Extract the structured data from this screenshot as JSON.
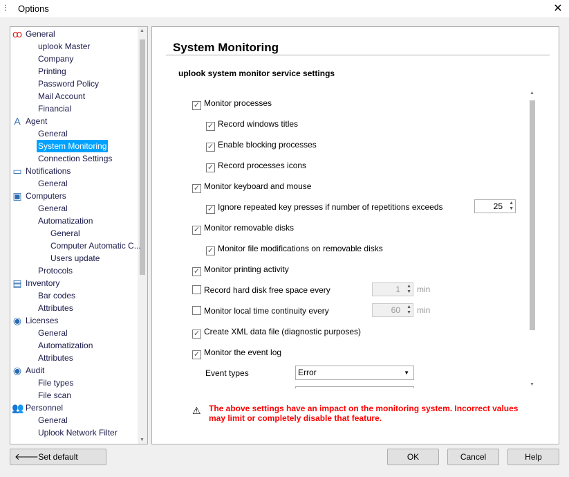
{
  "window": {
    "title": "Options",
    "close_icon": "close-icon"
  },
  "tree": {
    "items": [
      {
        "label": "General",
        "level": 0,
        "icon": "uplook-logo-icon"
      },
      {
        "label": "uplook Master",
        "level": 1
      },
      {
        "label": "Company",
        "level": 1
      },
      {
        "label": "Printing",
        "level": 1
      },
      {
        "label": "Password Policy",
        "level": 1
      },
      {
        "label": "Mail Account",
        "level": 1
      },
      {
        "label": "Financial",
        "level": 1
      },
      {
        "label": "Agent",
        "level": 0,
        "icon": "agent-a-icon"
      },
      {
        "label": "General",
        "level": 1
      },
      {
        "label": "System Monitoring",
        "level": 1,
        "selected": true
      },
      {
        "label": "Connection Settings",
        "level": 1
      },
      {
        "label": "Notifications",
        "level": 0,
        "icon": "chat-bubble-icon"
      },
      {
        "label": "General",
        "level": 1
      },
      {
        "label": "Computers",
        "level": 0,
        "icon": "computers-icon"
      },
      {
        "label": "General",
        "level": 1
      },
      {
        "label": "Automatization",
        "level": 1
      },
      {
        "label": "General",
        "level": 2
      },
      {
        "label": "Computer Automatic C...",
        "level": 2
      },
      {
        "label": "Users update",
        "level": 2
      },
      {
        "label": "Protocols",
        "level": 1
      },
      {
        "label": "Inventory",
        "level": 0,
        "icon": "inventory-icon"
      },
      {
        "label": "Bar codes",
        "level": 1
      },
      {
        "label": "Attributes",
        "level": 1
      },
      {
        "label": "Licenses",
        "level": 0,
        "icon": "disc-icon"
      },
      {
        "label": "General",
        "level": 1
      },
      {
        "label": "Automatization",
        "level": 1
      },
      {
        "label": "Attributes",
        "level": 1
      },
      {
        "label": "Audit",
        "level": 0,
        "icon": "disc-icon"
      },
      {
        "label": "File types",
        "level": 1
      },
      {
        "label": "File scan",
        "level": 1
      },
      {
        "label": "Personnel",
        "level": 0,
        "icon": "users-icon"
      },
      {
        "label": "General",
        "level": 1
      },
      {
        "label": "Uplook Network Filter",
        "level": 1
      }
    ]
  },
  "panel": {
    "title": "System Monitoring",
    "subtitle": "uplook system monitor service settings",
    "options": [
      {
        "label": "Monitor processes",
        "checked": true,
        "indent": 0
      },
      {
        "label": "Record windows titles",
        "checked": true,
        "indent": 1
      },
      {
        "label": "Enable blocking processes",
        "checked": true,
        "indent": 1
      },
      {
        "label": "Record processes icons",
        "checked": true,
        "indent": 1
      },
      {
        "label": "Monitor keyboard and mouse",
        "checked": true,
        "indent": 0
      },
      {
        "label": "Ignore repeated key presses if number of repetitions exceeds",
        "checked": true,
        "indent": 1,
        "value": "25"
      },
      {
        "label": "Monitor removable disks",
        "checked": true,
        "indent": 0
      },
      {
        "label": "Monitor file modifications on removable disks",
        "checked": true,
        "indent": 1
      },
      {
        "label": "Monitor printing activity",
        "checked": true,
        "indent": 0
      },
      {
        "label": "Record hard disk free space every",
        "checked": false,
        "indent": 0,
        "value": "1",
        "unit": "min",
        "disabled": true
      },
      {
        "label": "Monitor local time continuity every",
        "checked": false,
        "indent": 0,
        "value": "60",
        "unit": "min",
        "disabled": true
      },
      {
        "label": "Create XML data file (diagnostic purposes)",
        "checked": true,
        "indent": 0
      },
      {
        "label": "Monitor the event log",
        "checked": true,
        "indent": 0
      }
    ],
    "event_types_label": "Event types",
    "event_types_value": "Error",
    "warning": "The above settings have an impact on the monitoring system. Incorrect values may limit or completely disable that feature."
  },
  "buttons": {
    "set_default": "Set default",
    "ok": "OK",
    "cancel": "Cancel",
    "help": "Help"
  }
}
